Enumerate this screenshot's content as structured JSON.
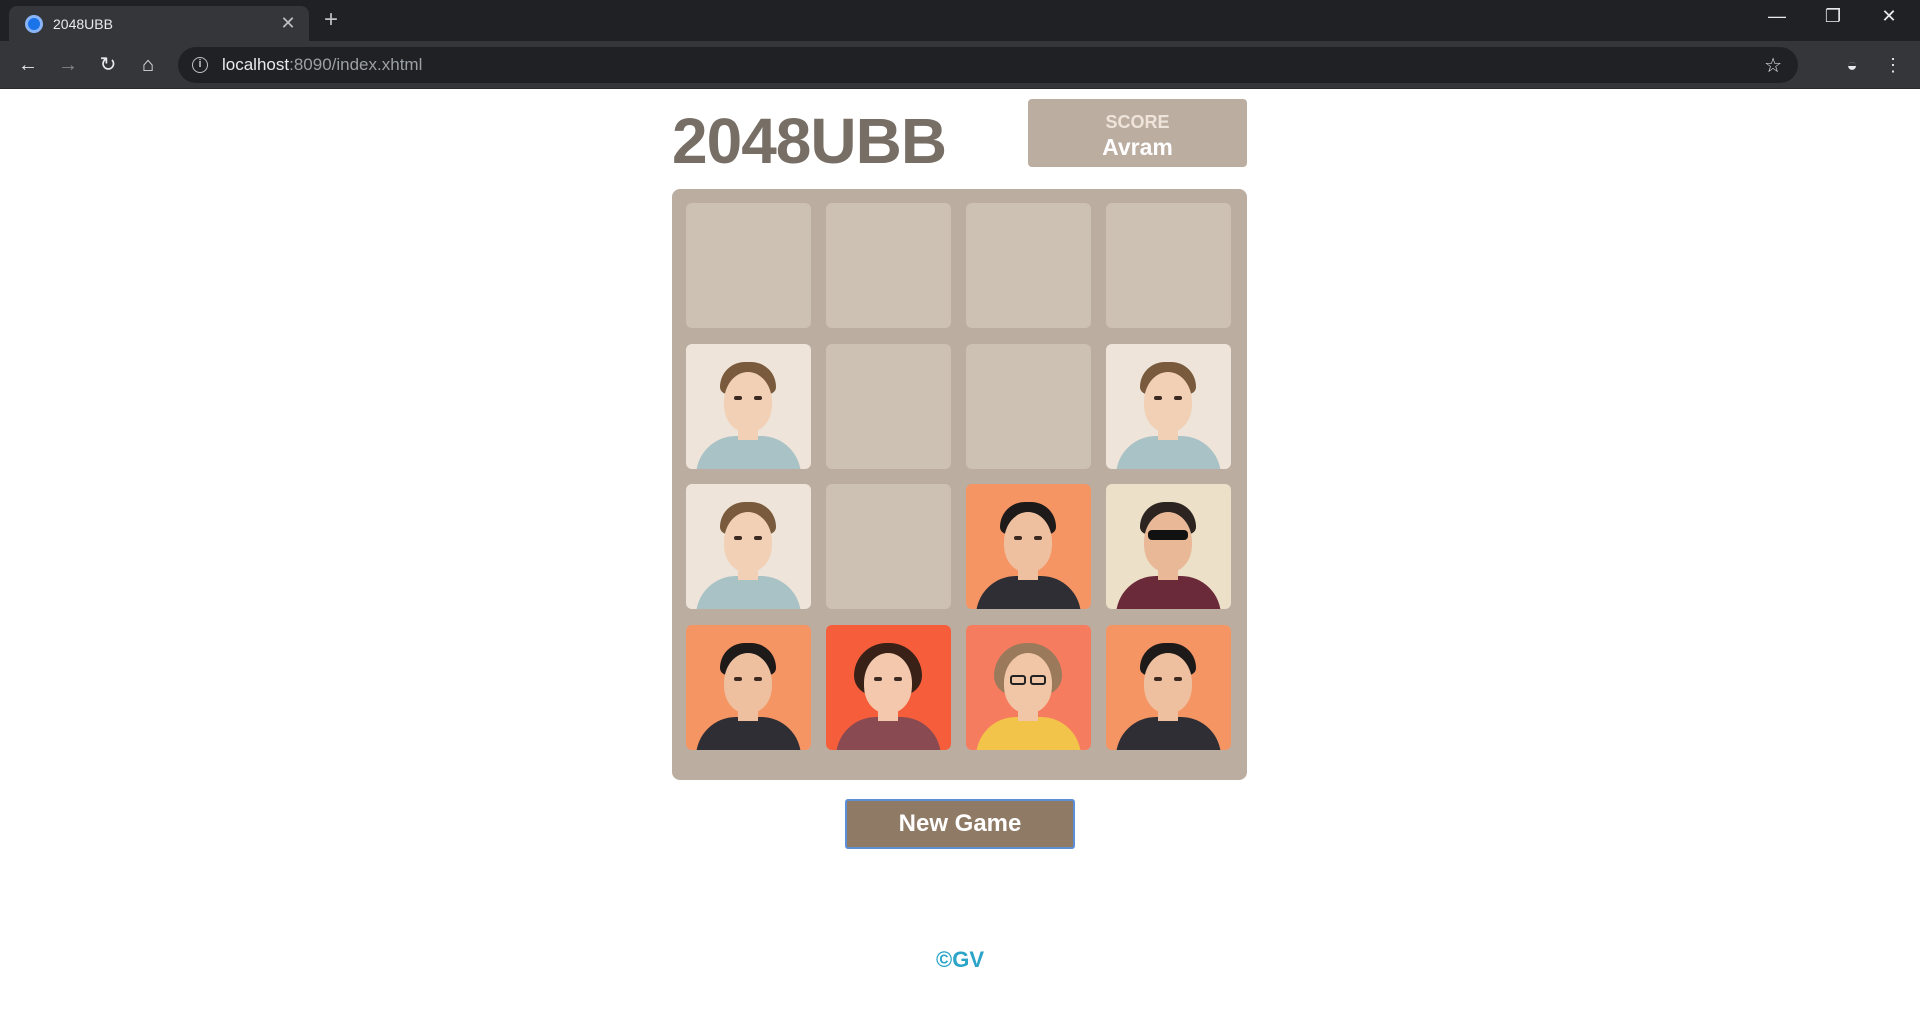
{
  "browser": {
    "tab_title": "2048UBB",
    "url_host": "localhost",
    "url_rest": ":8090/index.xhtml"
  },
  "game": {
    "title": "2048UBB",
    "score_label": "SCORE",
    "score_value": "Avram",
    "new_game_label": "New Game",
    "footer": "©GV"
  },
  "board": {
    "rows": [
      [
        "empty",
        "empty",
        "empty",
        "empty"
      ],
      [
        "blonde-man",
        "empty",
        "empty",
        "blonde-man"
      ],
      [
        "blonde-man",
        "empty",
        "dark-hair-man",
        "sunglasses-man"
      ],
      [
        "dark-hair-man",
        "brunette-woman",
        "curly-hair-woman",
        "dark-hair-man"
      ]
    ]
  },
  "colors": {
    "empty_cell": "#cdc1b4",
    "board": "#bbada0",
    "tile_light": "#eee4da",
    "tile_cream": "#ede0c8",
    "tile_orange": "#f59563",
    "tile_red": "#f67c5f",
    "tile_redder": "#f65e3b",
    "button": "#8f7a66",
    "title": "#776e65",
    "footer": "#2aa4c7"
  }
}
